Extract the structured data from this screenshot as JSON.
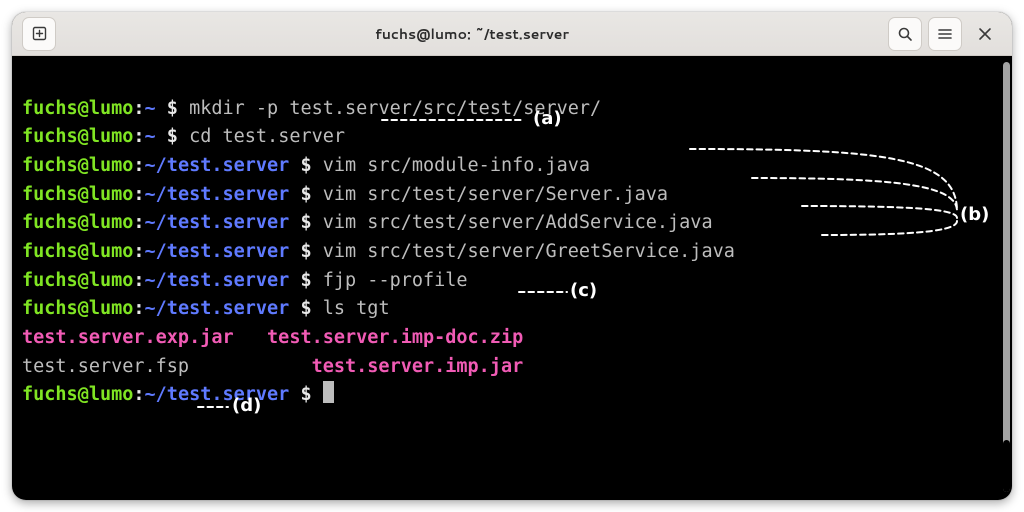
{
  "titlebar": {
    "title": "fuchs@lumo: ~/test.server"
  },
  "prompt_home": {
    "user": "fuchs@lumo",
    "colon": ":",
    "path": "~",
    "dollar": " $ "
  },
  "prompt_server": {
    "user": "fuchs@lumo",
    "colon": ":",
    "path": "~/test.server",
    "dollar": " $ "
  },
  "cmds": {
    "mkdir": "mkdir -p test.server/src/test/server/",
    "cd": "cd test.server",
    "vim1": "vim src/module-info.java",
    "vim2": "vim src/test/server/Server.java",
    "vim3": "vim src/test/server/AddService.java",
    "vim4": "vim src/test/server/GreetService.java",
    "fjp": "fjp --profile",
    "ls": "ls tgt"
  },
  "ls_output": {
    "col": {
      "exp_jar": "test.server.exp.jar",
      "imp_doc": "test.server.imp-doc.zip",
      "fsp": "test.server.fsp",
      "imp_jar": "test.server.imp.jar"
    }
  },
  "annots": {
    "a": "(a)",
    "b": "(b)",
    "c": "(c)",
    "d": "(d)"
  }
}
